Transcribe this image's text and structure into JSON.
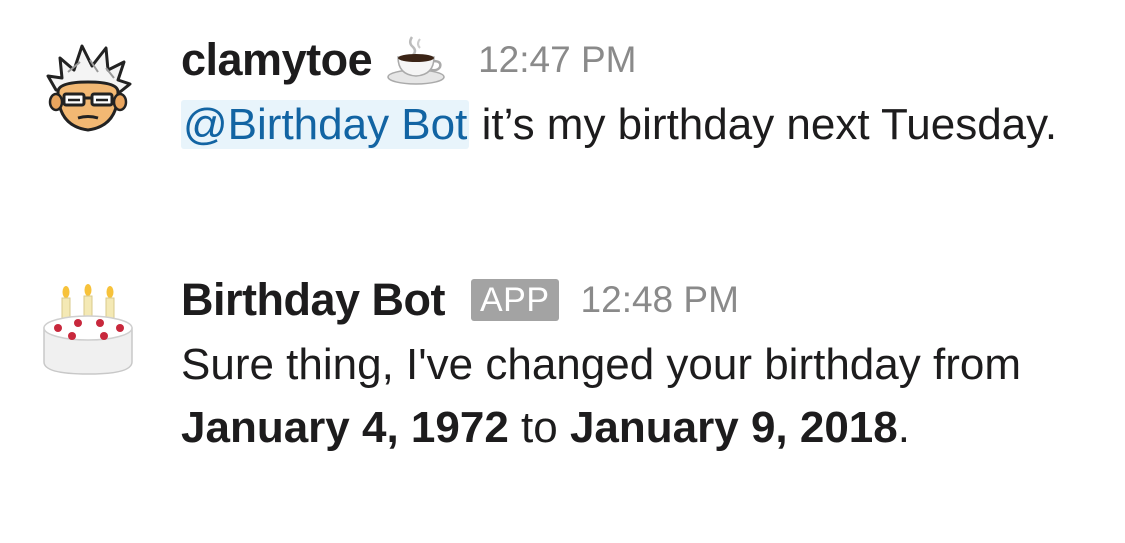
{
  "messages": [
    {
      "username": "clamytoe",
      "status_emoji": "coffee-icon",
      "timestamp": "12:47 PM",
      "mention": "@Birthday Bot",
      "text": " it’s my birthday next Tuesday."
    },
    {
      "username": "Birthday Bot",
      "badge": "APP",
      "timestamp": "12:48 PM",
      "text_before": "Sure thing, I've changed your birthday from ",
      "old_date": "January 4, 1972",
      "text_mid": " to ",
      "new_date": "January 9, 2018",
      "text_end": "."
    }
  ],
  "colors": {
    "mention_text": "#1264a3",
    "mention_bg": "#e8f4fb",
    "badge_bg": "#a3a3a3",
    "timestamp": "#8a8a8a"
  }
}
